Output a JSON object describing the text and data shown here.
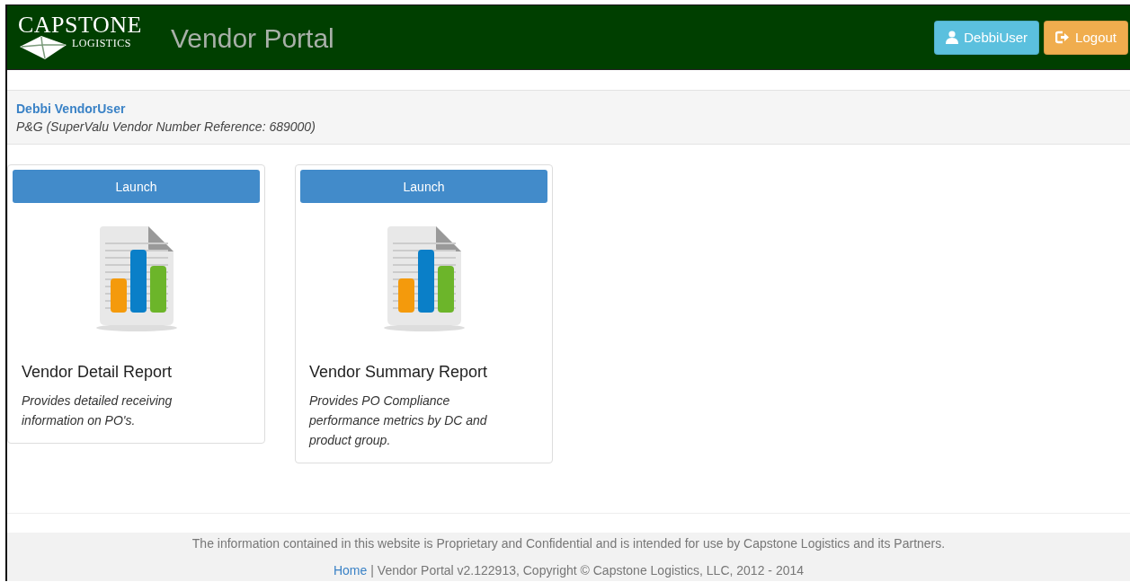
{
  "header": {
    "logo_top": "CAPSTONE",
    "logo_bottom": "LOGISTICS",
    "title": "Vendor Portal",
    "buttons": [
      {
        "kind": "user",
        "label": "DebbiUser"
      },
      {
        "kind": "logout",
        "label": "Logout"
      }
    ]
  },
  "user_panel": {
    "name": "Debbi VendorUser",
    "detail": "P&G (SuperValu Vendor Number Reference: 689000)"
  },
  "reports": [
    {
      "button": "Launch",
      "title": "Vendor Detail Report",
      "description": "Provides detailed receiving information on PO's."
    },
    {
      "button": "Launch",
      "title": "Vendor Summary Report",
      "description": "Provides PO Compliance performance metrics by DC and product group."
    }
  ],
  "footer": {
    "notice": "The information contained in this website is Proprietary and Confidential and is intended for use by Capstone Logistics and its Partners.",
    "home_link": "Home",
    "copyright": "| Vendor Portal v2.122913, Copyright © Capstone Logistics, LLC, 2012 - 2014"
  }
}
